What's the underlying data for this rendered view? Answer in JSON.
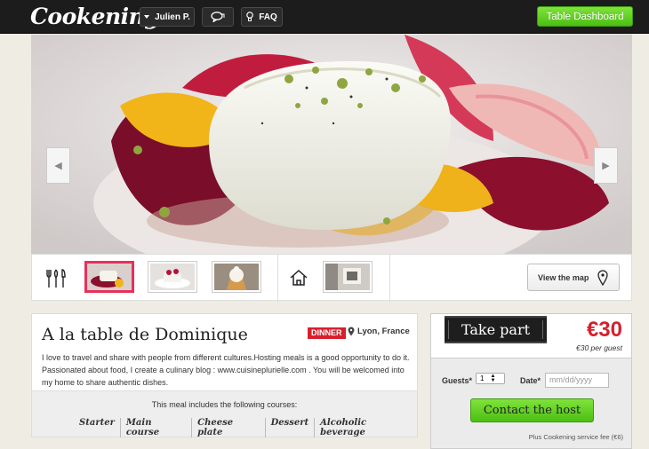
{
  "header": {
    "logo": "Cookening",
    "user_name": "Julien P.",
    "faq_label": "FAQ",
    "dashboard_label": "Table Dashboard"
  },
  "hero": {
    "prev_icon": "arrow-left-icon",
    "next_icon": "arrow-right-icon"
  },
  "thumb_strip": {
    "view_map_label": "View the map",
    "cutlery_icon": "cutlery-icon",
    "home_icon": "home-icon",
    "pin_icon": "map-pin-icon"
  },
  "meal": {
    "title": "A la table de Dominique",
    "badge": "DINNER",
    "location": "Lyon, France",
    "description": "I love to travel and share with people from different cultures.Hosting meals is a good opportunity to do it. Passionated about food, I create a culinary blog : www.cuisineplurielle.com . You will be welcomed into my home to share authentic dishes.",
    "courses_intro": "This meal includes the following courses:",
    "courses": [
      "Starter",
      "Main course",
      "Cheese plate",
      "Dessert",
      "Alcoholic beverage"
    ]
  },
  "booking": {
    "take_part_label": "Take part",
    "price": "€30",
    "per_guest": "€30 per guest",
    "guests_label": "Guests*",
    "guests_value": "1",
    "date_label": "Date*",
    "date_placeholder": "mm/dd/yyyy",
    "contact_label": "Contact the host",
    "fee_note": "Plus Cookening service fee (€6)"
  },
  "colors": {
    "accent_green": "#4cbf14",
    "accent_red": "#d71f2d",
    "header_bg": "#1c1c1c"
  }
}
